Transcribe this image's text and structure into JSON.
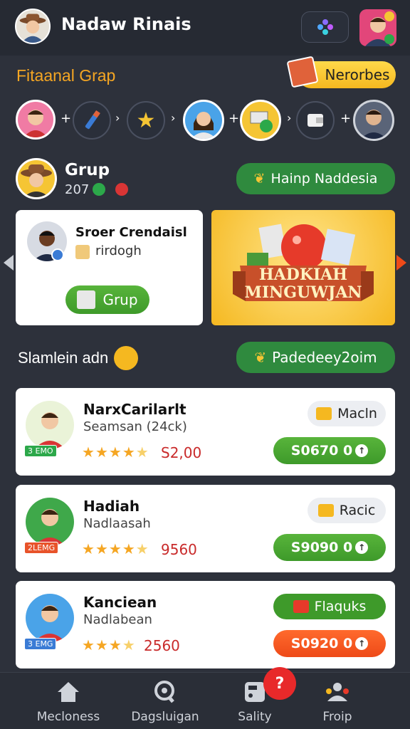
{
  "header": {
    "name": "Nadaw Rinais"
  },
  "section1": {
    "title": "Fitaanal Grap",
    "badge": "Nerorbes"
  },
  "group": {
    "name": "Grup",
    "count": "207",
    "button": "Hainp Naddesia"
  },
  "profile_card": {
    "name": "Sroer Crendaisl",
    "sub": "rirdogh",
    "button": "Grup"
  },
  "promo": {
    "line1": "HADKIAH",
    "line2": "MINGUWJAN"
  },
  "section2": {
    "title": "Slamlein adn",
    "button": "Padedeey2oim"
  },
  "list": [
    {
      "title": "NarxCarilarlt",
      "sub": "Seamsan (24ck)",
      "tag": "3 EMO",
      "rating": "S2,00",
      "badge": "Macln",
      "price": "S0670 0",
      "stars": 4.5
    },
    {
      "title": "Hadiah",
      "sub": "Nadlaasah",
      "tag": "2LEMG",
      "rating": "9560",
      "badge": "Racic",
      "price": "S9090 0",
      "stars": 4.5
    },
    {
      "title": "Kanciean",
      "sub": "Nadlabean",
      "tag": "3 EMG",
      "rating": "2560",
      "badge": "Flaquks",
      "price": "S0920 0",
      "stars": 3.5
    }
  ],
  "nav": [
    {
      "label": "Mecloness",
      "icon": "home-icon"
    },
    {
      "label": "Dagsluigan",
      "icon": "search-icon"
    },
    {
      "label": "Sality",
      "icon": "cart-icon"
    },
    {
      "label": "Froip",
      "icon": "group-icon"
    }
  ],
  "notify_badge": "?",
  "colors": {
    "bg": "#2d313b",
    "green": "#3e9a2a",
    "orange": "#ee4a18",
    "gold": "#f5a623",
    "promo": "#f5c534"
  }
}
